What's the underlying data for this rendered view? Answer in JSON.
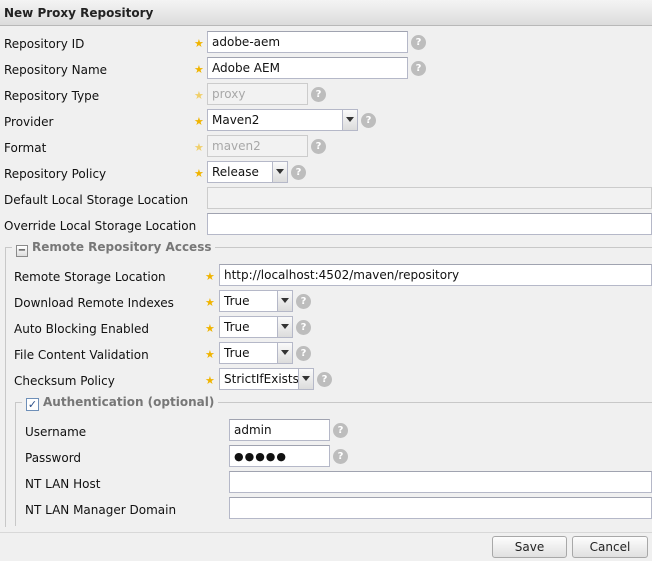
{
  "window": {
    "title": "New Proxy Repository"
  },
  "fields": {
    "repository_id": {
      "label": "Repository ID",
      "value": "adobe-aem"
    },
    "repository_name": {
      "label": "Repository Name",
      "value": "Adobe AEM"
    },
    "repository_type": {
      "label": "Repository Type",
      "value": "proxy"
    },
    "provider": {
      "label": "Provider",
      "value": "Maven2"
    },
    "format": {
      "label": "Format",
      "value": "maven2"
    },
    "repository_policy": {
      "label": "Repository Policy",
      "value": "Release"
    },
    "default_storage": {
      "label": "Default Local Storage Location",
      "value": ""
    },
    "override_storage": {
      "label": "Override Local Storage Location",
      "value": ""
    }
  },
  "remote": {
    "legend": "Remote Repository Access",
    "toggle_glyph": "−",
    "remote_storage": {
      "label": "Remote Storage Location",
      "value": "http://localhost:4502/maven/repository"
    },
    "download_indexes": {
      "label": "Download Remote Indexes",
      "value": "True"
    },
    "auto_blocking": {
      "label": "Auto Blocking Enabled",
      "value": "True"
    },
    "file_validation": {
      "label": "File Content Validation",
      "value": "True"
    },
    "checksum_policy": {
      "label": "Checksum Policy",
      "value": "StrictIfExists"
    }
  },
  "auth": {
    "legend": "Authentication (optional)",
    "checked_glyph": "✓",
    "username": {
      "label": "Username",
      "value": "admin"
    },
    "password": {
      "label": "Password",
      "value": "●●●●●"
    },
    "nt_host": {
      "label": "NT LAN Host",
      "value": ""
    },
    "nt_domain": {
      "label": "NT LAN Manager Domain",
      "value": ""
    }
  },
  "help_glyph": "?",
  "required_glyph": "★",
  "buttons": {
    "save": "Save",
    "cancel": "Cancel"
  }
}
